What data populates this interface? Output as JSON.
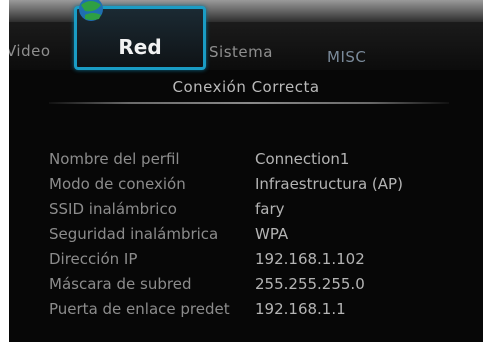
{
  "tabs": {
    "video": "Video",
    "red": "Red",
    "sistema": "Sistema",
    "misc": "MISC"
  },
  "status": "Conexión Correcta",
  "details": [
    {
      "label": "Nombre del perfil",
      "value": "Connection1"
    },
    {
      "label": "Modo de conexión",
      "value": "Infraestructura (AP)"
    },
    {
      "label": "SSID inalámbrico",
      "value": "fary"
    },
    {
      "label": "Seguridad inalámbrica",
      "value": "WPA"
    },
    {
      "label": "Dirección IP",
      "value": "192.168.1.102"
    },
    {
      "label": "Máscara de subred",
      "value": "255.255.255.0"
    },
    {
      "label": "Puerta de enlace predet",
      "value": "192.168.1.1"
    }
  ],
  "colors": {
    "background": "#070707",
    "selected_tab_border": "#1a9cc4",
    "label_text": "#8c8c8c",
    "value_text": "#b4b4b4"
  },
  "icons": {
    "selected_tab_logo": "network-globe-icon"
  }
}
